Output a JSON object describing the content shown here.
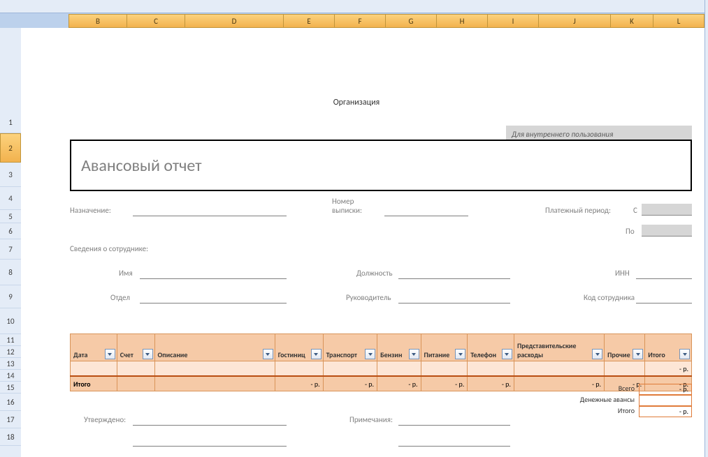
{
  "columns": [
    "B",
    "C",
    "D",
    "E",
    "F",
    "G",
    "H",
    "I",
    "J",
    "K",
    "L"
  ],
  "rows_before_1": 5,
  "rows": [
    "1",
    "2",
    "3",
    "4",
    "5",
    "6",
    "7",
    "8",
    "9",
    "10",
    "11",
    "12",
    "13",
    "14",
    "15",
    "16",
    "17",
    "18"
  ],
  "selected_row": "2",
  "header": {
    "organization": "Организация",
    "internal_use": "Для внутреннего пользования",
    "title": "Авансовый отчет"
  },
  "labels": {
    "purpose": "Назначение:",
    "statement_no": "Номер выписки:",
    "pay_period": "Платежный период:",
    "from": "С",
    "to": "По",
    "employee_info": "Сведения о сотруднике:",
    "name": "Имя",
    "position_lbl": "Должность",
    "inn": "ИНН",
    "department": "Отдел",
    "manager": "Руководитель",
    "emp_code": "Код сотрудника",
    "approved": "Утверждено:",
    "notes": "Примечания:"
  },
  "fields": {
    "purpose": "",
    "statement_no": "",
    "pay_from": "",
    "pay_to": "",
    "name": "",
    "position": "",
    "inn": "",
    "department": "",
    "manager": "",
    "emp_code": "",
    "approved": "",
    "notes": ""
  },
  "table": {
    "headers": [
      "Дата",
      "Счет",
      "Описание",
      "Гостиниц",
      "Транспорт",
      "Бензин",
      "Питание",
      "Телефон",
      "Представительские расходы",
      "Прочие",
      "Итого"
    ],
    "data_row": [
      "",
      "",
      "",
      "",
      "",
      "",
      "",
      "",
      "",
      "",
      "-   р."
    ],
    "total_row": [
      "Итого",
      "",
      "",
      "-   р.",
      "-   р.",
      "-   р.",
      "-   р.",
      "-   р.",
      "-   р.",
      "-   р.",
      "-   р."
    ],
    "currency": "р."
  },
  "summary": {
    "rows": [
      {
        "label": "Всего",
        "value": "-   р."
      },
      {
        "label": "Денежные авансы",
        "value": ""
      },
      {
        "label": "Итого",
        "value": "-   р."
      }
    ]
  }
}
